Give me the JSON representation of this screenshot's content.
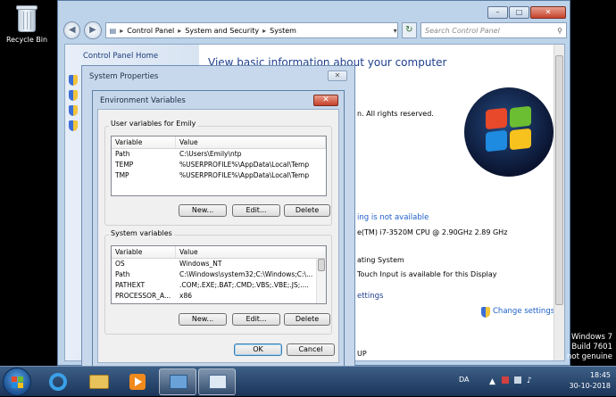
{
  "desktop": {
    "recycle_bin_label": "Recycle Bin"
  },
  "control_panel": {
    "breadcrumb": [
      "Control Panel",
      "System and Security",
      "System"
    ],
    "search_placeholder": "Search Control Panel",
    "left_home": "Control Panel Home",
    "main_title": "View basic information about your computer",
    "copyright": "n.  All rights reserved.",
    "rating_link": "ing is not available",
    "processor": "e(TM) i7-3520M CPU @ 2.90GHz   2.89 GHz",
    "os_type": "ating System",
    "touch": "Touch Input is available for this Display",
    "settings_head": "ettings",
    "change_settings": "Change settings",
    "up_fragment": "UP"
  },
  "system_properties": {
    "title": "System Properties"
  },
  "env_vars": {
    "title": "Environment Variables",
    "user_group_label": "User variables for Emily",
    "columns": [
      "Variable",
      "Value"
    ],
    "user_rows": [
      {
        "var": "Path",
        "val": "C:\\Users\\Emily\\ntp"
      },
      {
        "var": "TEMP",
        "val": "%USERPROFILE%\\AppData\\Local\\Temp"
      },
      {
        "var": "TMP",
        "val": "%USERPROFILE%\\AppData\\Local\\Temp"
      }
    ],
    "system_group_label": "System variables",
    "system_rows": [
      {
        "var": "OS",
        "val": "Windows_NT"
      },
      {
        "var": "Path",
        "val": "C:\\Windows\\system32;C:\\Windows;C:\\..."
      },
      {
        "var": "PATHEXT",
        "val": ".COM;.EXE;.BAT;.CMD;.VBS;.VBE;.JS;...."
      },
      {
        "var": "PROCESSOR_A...",
        "val": "x86"
      }
    ],
    "buttons": {
      "new": "New...",
      "edit": "Edit...",
      "delete": "Delete",
      "ok": "OK",
      "cancel": "Cancel"
    }
  },
  "taskbar": {
    "language": "DA",
    "time": "18:45",
    "date": "30-10-2018"
  },
  "watermark": {
    "line1": "Windows 7",
    "line2": "Build 7601",
    "line3": "not genuine"
  }
}
